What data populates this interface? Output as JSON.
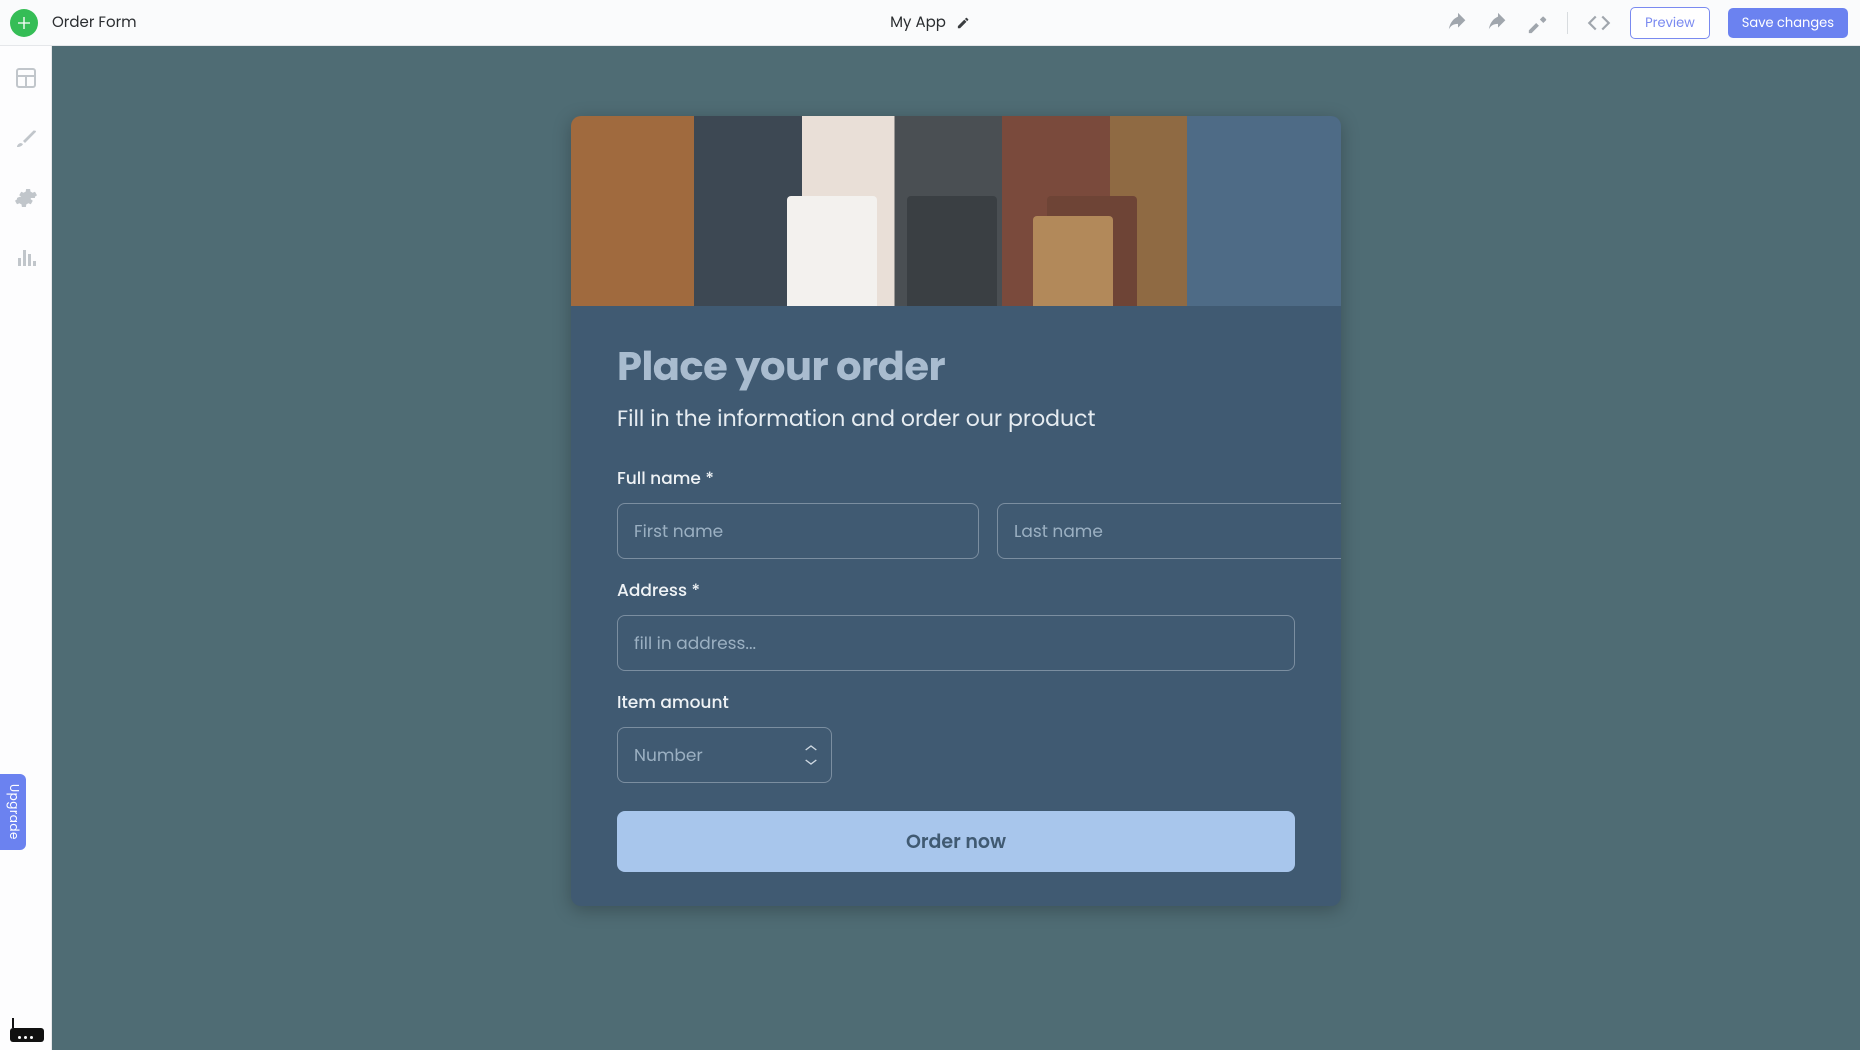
{
  "header": {
    "page_title": "Order Form",
    "app_name": "My App",
    "preview_label": "Preview",
    "save_label": "Save changes"
  },
  "sidebar": {
    "items": [
      "layout-icon",
      "brush-icon",
      "gear-icon",
      "chart-icon"
    ],
    "upgrade_label": "Upgrade"
  },
  "form": {
    "heading": "Place your order",
    "subheading": "Fill in the information and order our product",
    "full_name_label": "Full name *",
    "first_name_placeholder": "First name",
    "last_name_placeholder": "Last name",
    "address_label": "Address *",
    "address_placeholder": "fill in address...",
    "item_amount_label": "Item amount",
    "item_amount_placeholder": "Number",
    "submit_label": "Order now"
  }
}
